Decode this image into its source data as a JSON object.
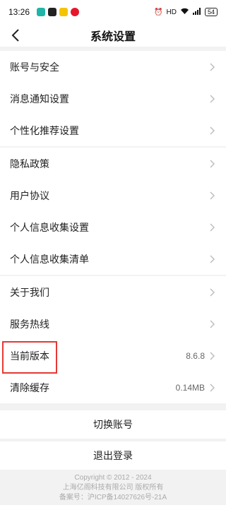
{
  "status_bar": {
    "time": "13:26",
    "icons": [
      "app-icon-teal",
      "app-icon-dark",
      "app-icon-yellow",
      "weibo-icon"
    ],
    "right_text": "HD",
    "battery": "54"
  },
  "header": {
    "title": "系统设置"
  },
  "groups": [
    {
      "items": [
        {
          "label": "账号与安全"
        },
        {
          "label": "消息通知设置"
        },
        {
          "label": "个性化推荐设置"
        }
      ]
    },
    {
      "items": [
        {
          "label": "隐私政策"
        },
        {
          "label": "用户协议"
        },
        {
          "label": "个人信息收集设置"
        },
        {
          "label": "个人信息收集清单"
        }
      ]
    },
    {
      "items": [
        {
          "label": "关于我们"
        },
        {
          "label": "服务热线"
        },
        {
          "label": "当前版本",
          "value": "8.6.8"
        },
        {
          "label": "清除缓存",
          "value": "0.14MB"
        }
      ]
    }
  ],
  "buttons": {
    "switch_account": "切换账号",
    "logout": "退出登录"
  },
  "footer": {
    "copyright": "Copyright © 2012 - 2024",
    "company": "上海亿阁科技有限公司 版权所有",
    "icp": "备案号：沪ICP备14027626号-21A"
  },
  "colors": {
    "accent_highlight": "#e53935",
    "background": "#f2f2f2"
  }
}
